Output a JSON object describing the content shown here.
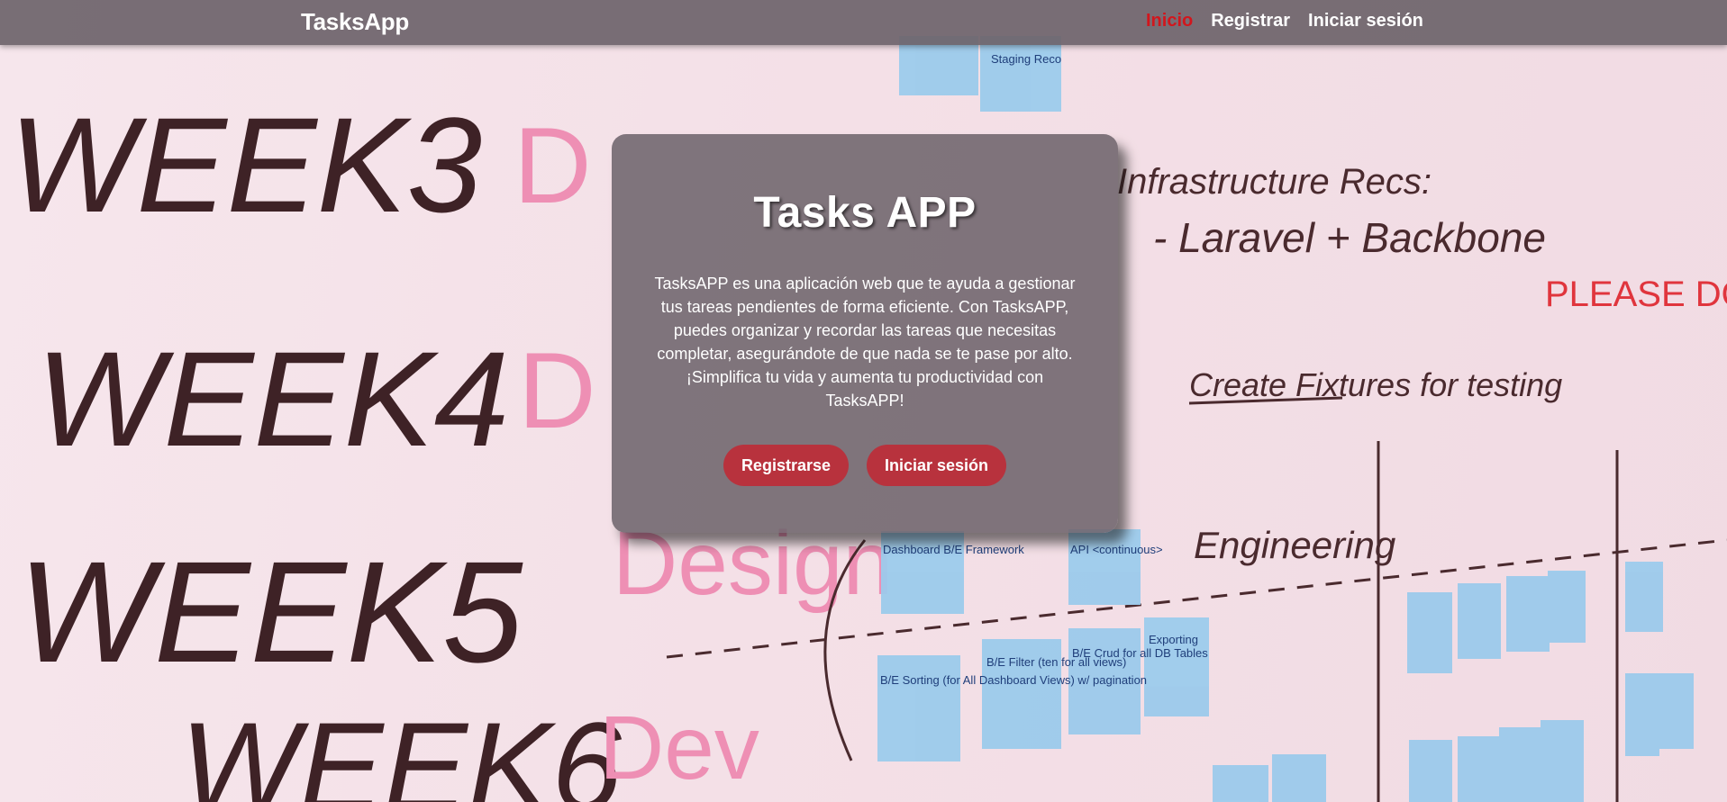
{
  "navbar": {
    "brand": "TasksApp",
    "links": [
      {
        "label": "Inicio",
        "active": true
      },
      {
        "label": "Registrar",
        "active": false
      },
      {
        "label": "Iniciar sesión",
        "active": false
      }
    ]
  },
  "hero": {
    "title": "Tasks APP",
    "description": "TasksAPP es una aplicación web que te ayuda a gestionar tus tareas pendientes de forma eficiente. Con TasksAPP, puedes organizar y recordar las tareas que necesitas completar, asegurándote de que nada se te pase por alto. ¡Simplifica tu vida y aumenta tu productividad con TasksAPP!",
    "buttons": {
      "register": "Registrarse",
      "login": "Iniciar sesión"
    }
  },
  "background_board": {
    "weeks": [
      "WEEK3",
      "WEEK4",
      "WEEK5",
      "WEEK6"
    ],
    "pink_labels": [
      "D",
      "D",
      "Design",
      "Dev"
    ],
    "notes_text": [
      "Infrastructure Recs:",
      "- Laravel + Backbone",
      "PLEASE DO NOT ERASE",
      "Create Fixtures for testing",
      "Engineering"
    ],
    "sticky_notes": [
      "Staging Reco",
      "Dashboard B/E Framework",
      "API <continuous>",
      "B/E Sorting (for All Dashboard Views) w/ pagination",
      "B/E Filter (ten for all views)",
      "B/E Crud for all DB Tables",
      "Exporting"
    ]
  },
  "colors": {
    "navbar_bg": "#6e646c",
    "active_link": "#d2161d",
    "button_bg": "#b8323d",
    "sticky_note": "#9ccbec",
    "marker_dark": "#4a2a2e",
    "marker_pink": "#ee8fb4"
  }
}
